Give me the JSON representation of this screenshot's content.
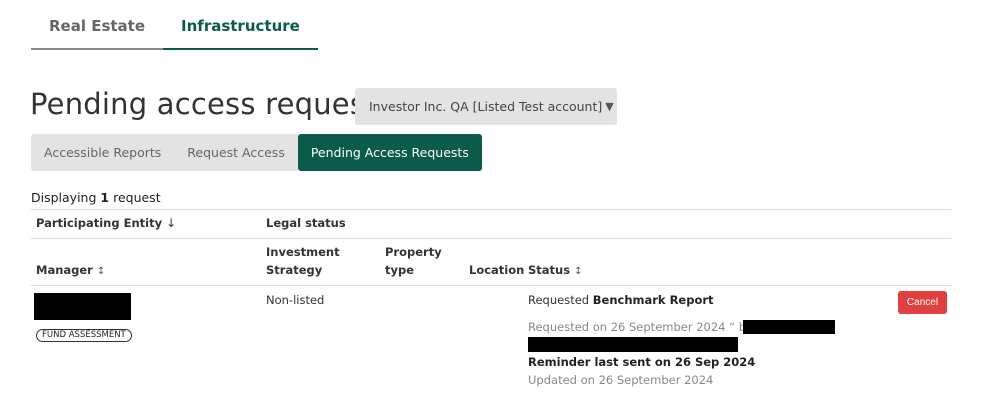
{
  "top_tabs": [
    {
      "label": "Real Estate",
      "active": false
    },
    {
      "label": "Infrastructure",
      "active": true
    }
  ],
  "page_title": "Pending access requests",
  "account_select": {
    "value": "Investor Inc. QA [Listed Test account]",
    "caret": "▼"
  },
  "sub_tabs": [
    {
      "label": "Accessible Reports",
      "active": false
    },
    {
      "label": "Request Access",
      "active": false
    },
    {
      "label": "Pending Access Requests",
      "active": true
    }
  ],
  "display": {
    "prefix": "Displaying",
    "count": "1",
    "suffix": "request"
  },
  "table": {
    "group_headers": {
      "participating_entity": "Participating Entity",
      "sort_arrow": "↓",
      "legal_status": "Legal status"
    },
    "columns": {
      "manager": "Manager",
      "investment_strategy_line1": "Investment",
      "investment_strategy_line2": "Strategy",
      "property_type_line1": "Property",
      "property_type_line2": "type",
      "location": "Location",
      "status": "Status",
      "sortable_icon": "↕"
    },
    "rows": [
      {
        "manager_badge": "FUND ASSESSMENT",
        "investment_strategy": "Non-listed",
        "status_requested_prefix": "Requested",
        "status_requested_item": "Benchmark Report",
        "requested_on": "Requested on 26 September 2024 “ by",
        "reminder": "Reminder last sent on 26 Sep 2024",
        "updated_on": "Updated on 26 September 2024",
        "action_label": "Cancel"
      }
    ]
  },
  "colors": {
    "accent": "#0b5b4b",
    "cancel": "#e04040",
    "tab_bg": "#e3e3e3"
  }
}
